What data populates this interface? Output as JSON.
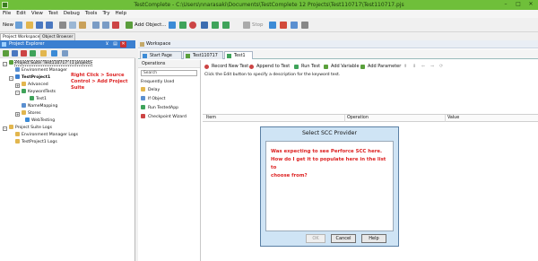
{
  "window": {
    "title": "TestComplete - C:\\Users\\nnarasaki\\Documents\\TestComplete 12 Projects\\Test110717\\Test110717.pjs"
  },
  "menu": [
    "File",
    "Edit",
    "View",
    "Test",
    "Debug",
    "Tools",
    "Try",
    "Help"
  ],
  "toolbar": {
    "new_label": "New",
    "add_object_label": "Add Object...",
    "stop_label": "Stop"
  },
  "side_tabs": [
    "Project Workspace",
    "Object Browser"
  ],
  "explorer": {
    "title": "Project Explorer",
    "tree": [
      {
        "label": "Project Suite 'Test110717' (1 project)",
        "selected": true
      },
      {
        "label": "Environment Manager"
      },
      {
        "label": "TestProject1",
        "bold": true
      },
      {
        "label": "Advanced"
      },
      {
        "label": "KeywordTests"
      },
      {
        "label": "Test1"
      },
      {
        "label": "NameMapping"
      },
      {
        "label": "Stores"
      },
      {
        "label": "WebTesting"
      },
      {
        "label": "Project Suite Logs"
      },
      {
        "label": "Environment Manager Logs"
      },
      {
        "label": "TestProject1 Logs"
      }
    ],
    "annotation": [
      "Right Click > Source",
      "Control > Add Project",
      "Suite"
    ]
  },
  "workspace": {
    "title": "Workspace",
    "tabs": [
      "Start Page",
      "Test110717",
      "Test1"
    ],
    "operations": {
      "title": "Operations",
      "search_placeholder": "Search",
      "category": "Frequently Used",
      "items": [
        "Delay",
        "If Object",
        "Run TestedApp",
        "Checkpoint Wizard"
      ]
    },
    "editor": {
      "buttons": [
        "Record New Test",
        "Append to Test",
        "Run Test",
        "Add Variable",
        "Add Parameter"
      ],
      "hint": "Click the Edit button to specify a description for the keyword test.",
      "columns": [
        "Item",
        "Operation",
        "Value"
      ]
    }
  },
  "dialog": {
    "title": "Select SCC Provider",
    "message": [
      "Was expecting to see Perforce SCC here.",
      "How do I get it to populate here in the list to",
      "choose from?"
    ],
    "buttons": {
      "ok": "OK",
      "cancel": "Cancel",
      "help": "Help"
    }
  }
}
